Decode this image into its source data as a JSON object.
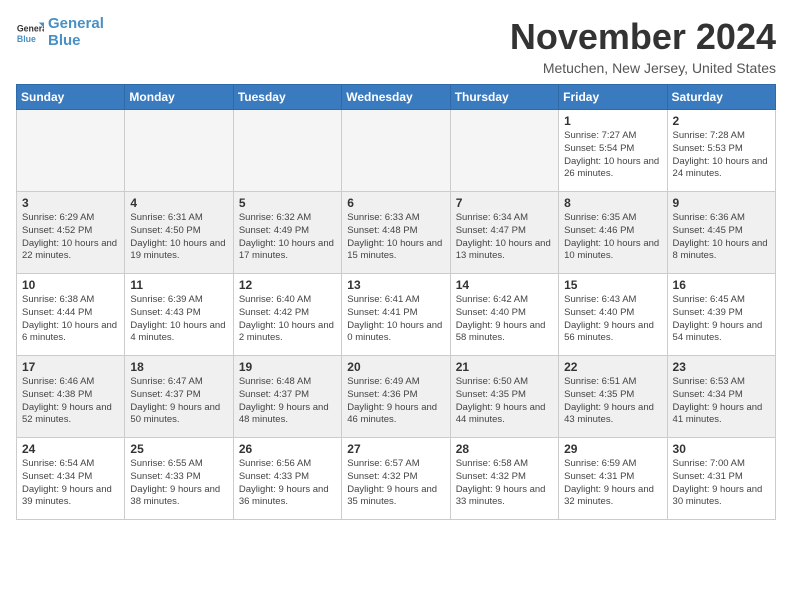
{
  "logo": {
    "line1": "General",
    "line2": "Blue"
  },
  "title": "November 2024",
  "location": "Metuchen, New Jersey, United States",
  "weekdays": [
    "Sunday",
    "Monday",
    "Tuesday",
    "Wednesday",
    "Thursday",
    "Friday",
    "Saturday"
  ],
  "weeks": [
    [
      {
        "day": "",
        "detail": ""
      },
      {
        "day": "",
        "detail": ""
      },
      {
        "day": "",
        "detail": ""
      },
      {
        "day": "",
        "detail": ""
      },
      {
        "day": "",
        "detail": ""
      },
      {
        "day": "1",
        "detail": "Sunrise: 7:27 AM\nSunset: 5:54 PM\nDaylight: 10 hours and 26 minutes."
      },
      {
        "day": "2",
        "detail": "Sunrise: 7:28 AM\nSunset: 5:53 PM\nDaylight: 10 hours and 24 minutes."
      }
    ],
    [
      {
        "day": "3",
        "detail": "Sunrise: 6:29 AM\nSunset: 4:52 PM\nDaylight: 10 hours and 22 minutes."
      },
      {
        "day": "4",
        "detail": "Sunrise: 6:31 AM\nSunset: 4:50 PM\nDaylight: 10 hours and 19 minutes."
      },
      {
        "day": "5",
        "detail": "Sunrise: 6:32 AM\nSunset: 4:49 PM\nDaylight: 10 hours and 17 minutes."
      },
      {
        "day": "6",
        "detail": "Sunrise: 6:33 AM\nSunset: 4:48 PM\nDaylight: 10 hours and 15 minutes."
      },
      {
        "day": "7",
        "detail": "Sunrise: 6:34 AM\nSunset: 4:47 PM\nDaylight: 10 hours and 13 minutes."
      },
      {
        "day": "8",
        "detail": "Sunrise: 6:35 AM\nSunset: 4:46 PM\nDaylight: 10 hours and 10 minutes."
      },
      {
        "day": "9",
        "detail": "Sunrise: 6:36 AM\nSunset: 4:45 PM\nDaylight: 10 hours and 8 minutes."
      }
    ],
    [
      {
        "day": "10",
        "detail": "Sunrise: 6:38 AM\nSunset: 4:44 PM\nDaylight: 10 hours and 6 minutes."
      },
      {
        "day": "11",
        "detail": "Sunrise: 6:39 AM\nSunset: 4:43 PM\nDaylight: 10 hours and 4 minutes."
      },
      {
        "day": "12",
        "detail": "Sunrise: 6:40 AM\nSunset: 4:42 PM\nDaylight: 10 hours and 2 minutes."
      },
      {
        "day": "13",
        "detail": "Sunrise: 6:41 AM\nSunset: 4:41 PM\nDaylight: 10 hours and 0 minutes."
      },
      {
        "day": "14",
        "detail": "Sunrise: 6:42 AM\nSunset: 4:40 PM\nDaylight: 9 hours and 58 minutes."
      },
      {
        "day": "15",
        "detail": "Sunrise: 6:43 AM\nSunset: 4:40 PM\nDaylight: 9 hours and 56 minutes."
      },
      {
        "day": "16",
        "detail": "Sunrise: 6:45 AM\nSunset: 4:39 PM\nDaylight: 9 hours and 54 minutes."
      }
    ],
    [
      {
        "day": "17",
        "detail": "Sunrise: 6:46 AM\nSunset: 4:38 PM\nDaylight: 9 hours and 52 minutes."
      },
      {
        "day": "18",
        "detail": "Sunrise: 6:47 AM\nSunset: 4:37 PM\nDaylight: 9 hours and 50 minutes."
      },
      {
        "day": "19",
        "detail": "Sunrise: 6:48 AM\nSunset: 4:37 PM\nDaylight: 9 hours and 48 minutes."
      },
      {
        "day": "20",
        "detail": "Sunrise: 6:49 AM\nSunset: 4:36 PM\nDaylight: 9 hours and 46 minutes."
      },
      {
        "day": "21",
        "detail": "Sunrise: 6:50 AM\nSunset: 4:35 PM\nDaylight: 9 hours and 44 minutes."
      },
      {
        "day": "22",
        "detail": "Sunrise: 6:51 AM\nSunset: 4:35 PM\nDaylight: 9 hours and 43 minutes."
      },
      {
        "day": "23",
        "detail": "Sunrise: 6:53 AM\nSunset: 4:34 PM\nDaylight: 9 hours and 41 minutes."
      }
    ],
    [
      {
        "day": "24",
        "detail": "Sunrise: 6:54 AM\nSunset: 4:34 PM\nDaylight: 9 hours and 39 minutes."
      },
      {
        "day": "25",
        "detail": "Sunrise: 6:55 AM\nSunset: 4:33 PM\nDaylight: 9 hours and 38 minutes."
      },
      {
        "day": "26",
        "detail": "Sunrise: 6:56 AM\nSunset: 4:33 PM\nDaylight: 9 hours and 36 minutes."
      },
      {
        "day": "27",
        "detail": "Sunrise: 6:57 AM\nSunset: 4:32 PM\nDaylight: 9 hours and 35 minutes."
      },
      {
        "day": "28",
        "detail": "Sunrise: 6:58 AM\nSunset: 4:32 PM\nDaylight: 9 hours and 33 minutes."
      },
      {
        "day": "29",
        "detail": "Sunrise: 6:59 AM\nSunset: 4:31 PM\nDaylight: 9 hours and 32 minutes."
      },
      {
        "day": "30",
        "detail": "Sunrise: 7:00 AM\nSunset: 4:31 PM\nDaylight: 9 hours and 30 minutes."
      }
    ]
  ]
}
